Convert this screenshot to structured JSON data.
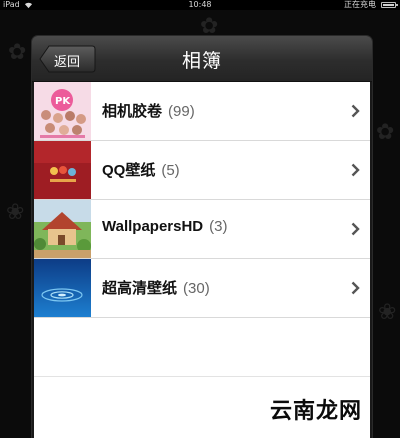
{
  "status_bar": {
    "carrier": "iPad",
    "time": "10:48",
    "charging_text": "正在充电"
  },
  "nav": {
    "back_label": "返回",
    "title": "相簿"
  },
  "albums": [
    {
      "name": "相机胶卷",
      "count": "(99)",
      "thumb_icon": "pink-pk-poster-thumbnail"
    },
    {
      "name": "QQ壁纸",
      "count": "(5)",
      "thumb_icon": "red-wallpaper-thumbnail"
    },
    {
      "name": "WallpapersHD",
      "count": "(3)",
      "thumb_icon": "cartoon-house-thumbnail"
    },
    {
      "name": "超高清壁纸",
      "count": "(30)",
      "thumb_icon": "water-drop-thumbnail"
    }
  ],
  "watermark": "云南龙网",
  "colors": {
    "nav_bar": "#2d2d2d",
    "list_bg": "#ffffff",
    "chevron": "#555555"
  }
}
